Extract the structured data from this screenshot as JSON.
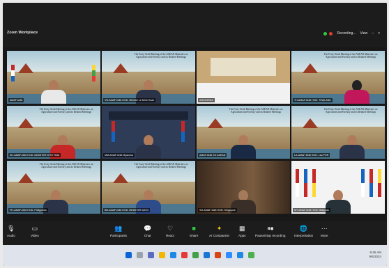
{
  "app": {
    "title": "Zoom Workplace"
  },
  "recording": {
    "label": "Recording...",
    "view_label": "View"
  },
  "meeting": {
    "banner_title": "The Forty-Sixth Meeting of the ASEAN Ministers on Agriculture and Forestry and its Related Meetings",
    "tiles": [
      {
        "label": "AMAF-M46",
        "active": true
      },
      {
        "label": "VN-AMAF-M46 HOD: Minister Le Minh Hoan"
      },
      {
        "label": "INDONESIA"
      },
      {
        "label": "TH-AMAF-M46 HOD: THAILAND"
      },
      {
        "label": "KH-AMAF-M46 HOD: MINISTER DITH TINA"
      },
      {
        "label": "MM-AMAF-M46 Myanmar"
      },
      {
        "label": "AMAF-M46 SG ASEAN"
      },
      {
        "label": "LA-AMAF-M46 HOD: Lao PDR"
      },
      {
        "label": "PH-AMAF-M46 HOD: Philippines"
      },
      {
        "label": "BN-AMAF-M46 HOD: MINISTER DATO"
      },
      {
        "label": "SG-AMAF-M46 HOD: Singapore"
      },
      {
        "label": "MY-AMAF-M46 HOD: Malaysia"
      }
    ]
  },
  "toolbar": {
    "audio": "Audio",
    "video": "Video",
    "participants": "Participants",
    "chat": "Chat",
    "react": "React",
    "share": "Share",
    "ai_companion": "AI Companion",
    "apps": "Apps",
    "pause_recording": "Pause/stop recording",
    "interpretation": "Interpretation",
    "more": "More"
  },
  "taskbar": {
    "time": "9:45 AM",
    "date": "9/6/2024"
  },
  "colors": {
    "accent": "#f3d21a",
    "toolbar_bg": "#1c1c1c",
    "taskbar_bg": "#dfe4ec"
  }
}
